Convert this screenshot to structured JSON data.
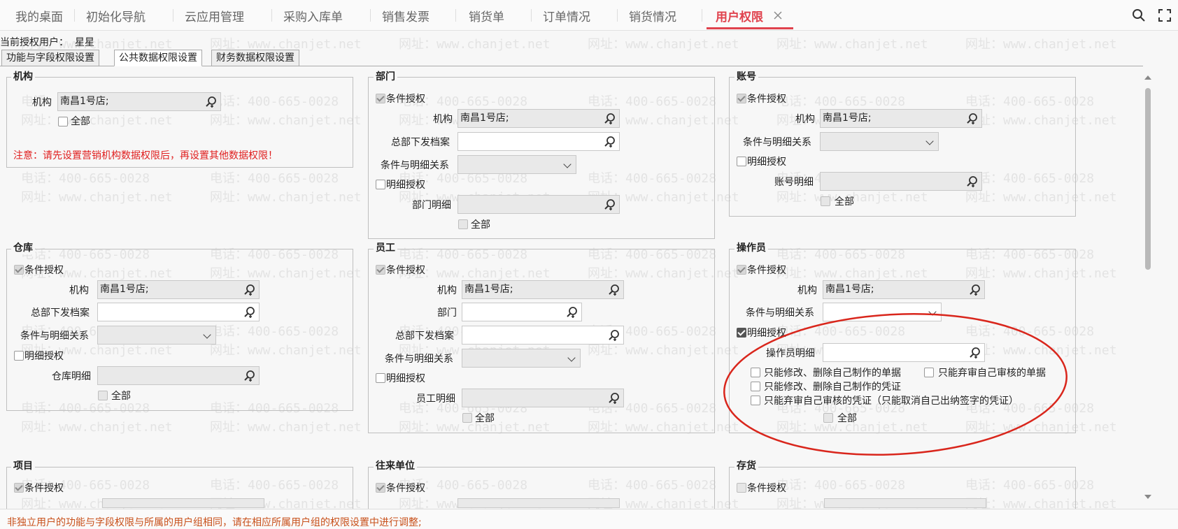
{
  "tabs": [
    "我的桌面",
    "初始化导航",
    "云应用管理",
    "采购入库单",
    "销售发票",
    "销货单",
    "订单情况",
    "销货情况",
    "用户权限"
  ],
  "current_user_label": "当前授权用户：",
  "current_user": "星星",
  "subtabs": [
    "功能与字段权限设置",
    "公共数据权限设置",
    "财务数据权限设置"
  ],
  "watermark": {
    "phone": "电话：400-665-0028",
    "web": "网址：www.chanjet.net"
  },
  "labels": {
    "cond_auth": "条件授权",
    "org": "机构",
    "hq_file": "总部下发档案",
    "cond_rel": "条件与明细关系",
    "detail_auth": "明细授权",
    "all": "全部",
    "dept": "部门"
  },
  "org_value": "南昌1号店;",
  "institution": {
    "title": "机构",
    "warning": "注意：请先设置营销机构数据权限后，再设置其他数据权限！"
  },
  "department": {
    "title": "部门",
    "detail_label": "部门明细"
  },
  "account": {
    "title": "账号",
    "detail_label": "账号明细"
  },
  "warehouse": {
    "title": "仓库",
    "detail_label": "仓库明细"
  },
  "employee": {
    "title": "员工",
    "detail_label": "员工明细"
  },
  "operator": {
    "title": "操作员",
    "detail_label": "操作员明细",
    "opt1": "只能修改、删除自己制作的单据",
    "opt2": "只能弃审自己审核的单据",
    "opt3": "只能修改、删除自己制作的凭证",
    "opt4": "只能弃审自己审核的凭证（只能取消自己出纳签字的凭证）"
  },
  "project": {
    "title": "项目"
  },
  "partner": {
    "title": "往来单位"
  },
  "inventory": {
    "title": "存货"
  },
  "bottom_note": "非独立用户的功能与字段权限与所属的用户组相同，请在相应所属用户组的权限设置中进行调整;",
  "colors": {
    "accent": "#e0424d",
    "warning": "#e02020",
    "note": "#c8501a",
    "highlight_ellipse": "#d9261c"
  },
  "icons": {
    "search": "search-icon",
    "expand": "fullscreen-icon",
    "close": "close-icon",
    "lookup": "lookup-magnifier-icon"
  }
}
